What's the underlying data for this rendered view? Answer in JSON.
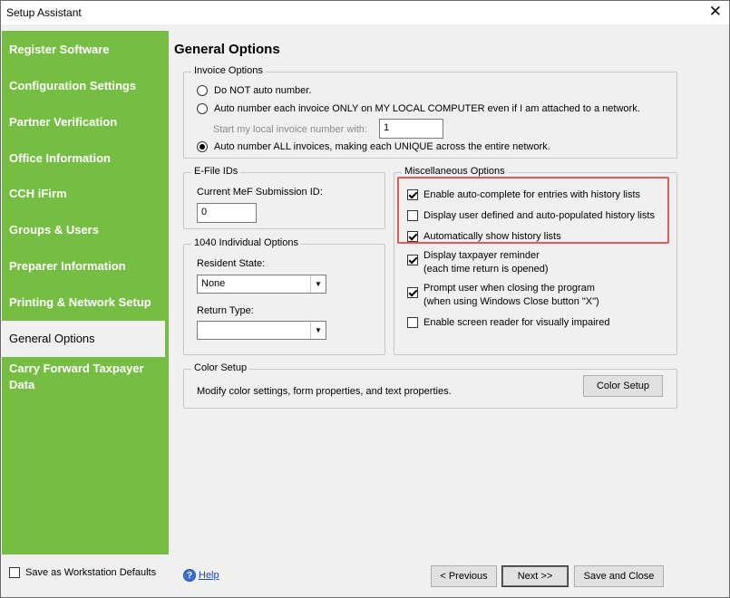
{
  "window": {
    "title": "Setup Assistant",
    "close_glyph": "✕"
  },
  "sidebar": {
    "items": [
      {
        "label": "Register Software"
      },
      {
        "label": "Configuration Settings"
      },
      {
        "label": "Partner Verification"
      },
      {
        "label": "Office Information"
      },
      {
        "label": "CCH iFirm"
      },
      {
        "label": "Groups & Users"
      },
      {
        "label": "Preparer Information"
      },
      {
        "label": "Printing & Network Setup"
      },
      {
        "label": "General Options",
        "active": true
      },
      {
        "label": "Carry Forward Taxpayer Data"
      }
    ],
    "colors": {
      "background": "#76bd43",
      "text": "#ffffff"
    }
  },
  "main": {
    "title": "General Options",
    "invoice_options": {
      "legend": "Invoice Options",
      "radio_not_auto": "Do NOT auto number.",
      "radio_local": "Auto number each invoice ONLY on MY LOCAL COMPUTER even if I am attached to a network.",
      "start_label": "Start my local invoice number with:",
      "start_value": "1",
      "radio_all": "Auto number ALL invoices, making each UNIQUE across the entire network.",
      "selected": "all"
    },
    "efile": {
      "legend": "E-File IDs",
      "mef_label": "Current MeF Submission ID:",
      "mef_value": "0"
    },
    "individual_1040": {
      "legend": "1040 Individual Options",
      "resident_label": "Resident State:",
      "resident_value": "None",
      "return_type_label": "Return Type:",
      "return_type_value": ""
    },
    "misc": {
      "legend": "Miscellaneous Options",
      "options": [
        {
          "label": "Enable auto-complete for entries with history lists",
          "checked": true
        },
        {
          "label": "Display user defined and auto-populated history lists",
          "checked": false
        },
        {
          "label": "Automatically show history lists",
          "checked": true
        },
        {
          "label": "Display taxpayer reminder",
          "sub": "(each time return is opened)",
          "checked": true
        },
        {
          "label": "Prompt user when closing the program",
          "sub": "(when using Windows Close button \"X\")",
          "checked": true
        },
        {
          "label": "Enable screen reader for visually impaired",
          "checked": false
        }
      ],
      "highlight_color": "#e05a5a"
    },
    "color_setup": {
      "legend": "Color Setup",
      "description": "Modify color settings, form properties, and text properties.",
      "button": "Color Setup"
    }
  },
  "footer": {
    "workstation_defaults": "Save as Workstation Defaults",
    "workstation_checked": false,
    "help": "Help",
    "help_icon": "?",
    "previous": "< Previous",
    "next": "Next >>",
    "save_close": "Save and Close"
  }
}
